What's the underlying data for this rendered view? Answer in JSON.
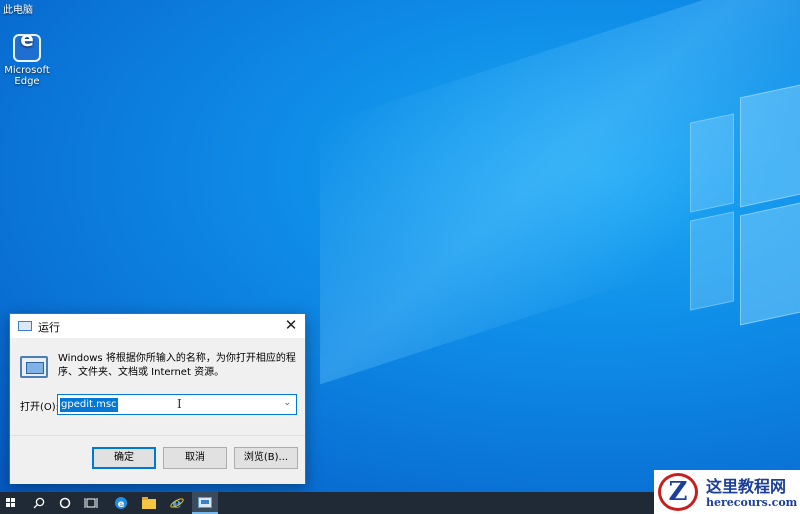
{
  "desktop": {
    "top_label": "此电脑",
    "icons": [
      {
        "label": "Microsoft Edge",
        "icon": "edge-icon"
      }
    ]
  },
  "run_dialog": {
    "title": "运行",
    "close_glyph": "✕",
    "description": "Windows 将根据你所输入的名称，为你打开相应的程序、文件夹、文档或 Internet 资源。",
    "open_label": "打开(O):",
    "input_value": "gpedit.msc",
    "buttons": {
      "ok": "确定",
      "cancel": "取消",
      "browse": "浏览(B)..."
    }
  },
  "taskbar": {
    "items": [
      "start-icon",
      "search-icon",
      "cortana-icon",
      "task-view-icon",
      "edge-icon",
      "file-explorer-icon",
      "ie-icon",
      "run-icon"
    ],
    "active_item": "run-icon"
  },
  "watermark": {
    "title": "这里教程网",
    "domain": "herecours.com"
  },
  "colors": {
    "accent": "#0078d7",
    "taskbar": "#1f2a36",
    "wallpaper": "#0f8ee8"
  }
}
